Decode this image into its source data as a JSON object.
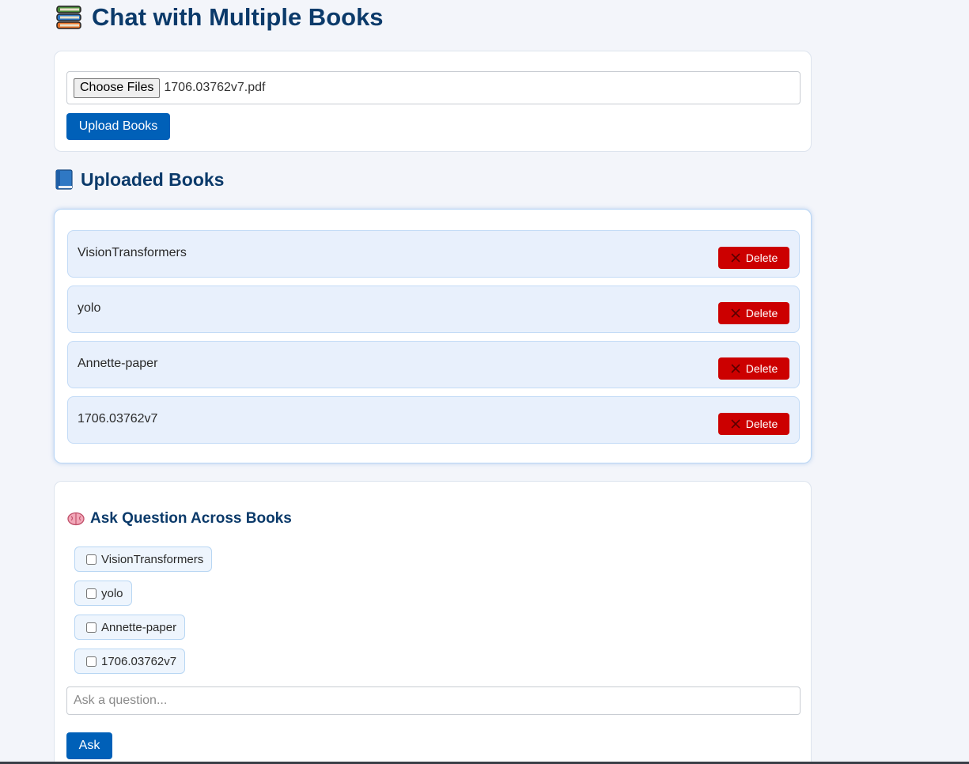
{
  "header": {
    "title": "Chat with Multiple Books",
    "icon": "books-icon"
  },
  "upload": {
    "choose_label": "Choose Files",
    "file_name": "1706.03762v7.pdf",
    "upload_label": "Upload Books"
  },
  "uploaded": {
    "title": "Uploaded Books",
    "icon": "book-icon",
    "delete_label": "Delete",
    "books": [
      {
        "name": "VisionTransformers"
      },
      {
        "name": "yolo"
      },
      {
        "name": "Annette-paper"
      },
      {
        "name": "1706.03762v7"
      }
    ]
  },
  "ask": {
    "title": "Ask Question Across Books",
    "icon": "brain-icon",
    "options": [
      {
        "label": "VisionTransformers",
        "checked": false
      },
      {
        "label": "yolo",
        "checked": false
      },
      {
        "label": "Annette-paper",
        "checked": false
      },
      {
        "label": "1706.03762v7",
        "checked": false
      }
    ],
    "placeholder": "Ask a question...",
    "ask_label": "Ask"
  },
  "colors": {
    "primary": "#0060b8",
    "danger": "#cc0000",
    "heading": "#0b3a6a",
    "background": "#f3f5fa"
  }
}
